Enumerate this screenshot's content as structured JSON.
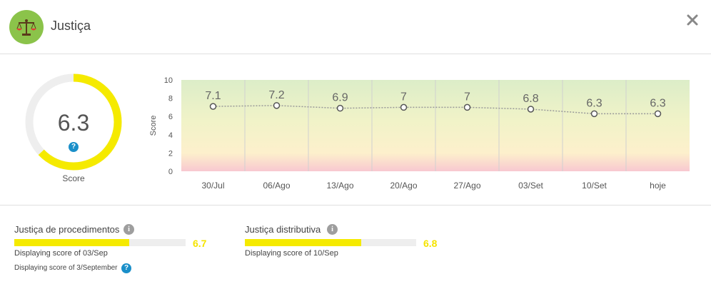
{
  "header": {
    "title": "Justiça",
    "icon": "balance-scale-icon",
    "close_icon": "close-icon"
  },
  "score": {
    "value": "6.3",
    "fraction": 0.63,
    "label": "Score",
    "help_glyph": "?"
  },
  "chart_data": {
    "type": "line",
    "categories": [
      "30/Jul",
      "06/Ago",
      "13/Ago",
      "20/Ago",
      "27/Ago",
      "03/Set",
      "10/Set",
      "hoje"
    ],
    "values": [
      7.1,
      7.2,
      6.9,
      7,
      7,
      6.8,
      6.3,
      6.3
    ],
    "data_labels": [
      "7.1",
      "7.2",
      "6.9",
      "7",
      "7",
      "6.8",
      "6.3",
      "6.3"
    ],
    "ylabel": "Score",
    "ylim": [
      0,
      10
    ],
    "yticks": [
      "0",
      "2",
      "4",
      "6",
      "8",
      "10"
    ],
    "background": "green-to-red gradient",
    "line_color": "#999999"
  },
  "subscores": [
    {
      "label": "Justiça de procedimentos",
      "value": "6.7",
      "fraction": 0.67,
      "displaying": "Displaying score of 03/Sep",
      "extra_note": "Displaying score of 3/September"
    },
    {
      "label": "Justiça distributiva",
      "value": "6.8",
      "fraction": 0.68,
      "displaying": "Displaying score of 10/Sep"
    }
  ],
  "colors": {
    "accent_yellow": "#f5ea00",
    "icon_green": "#8bc34a",
    "help_blue": "#1a8fc9",
    "info_grey": "#9e9e9e"
  },
  "info_glyph": "i"
}
